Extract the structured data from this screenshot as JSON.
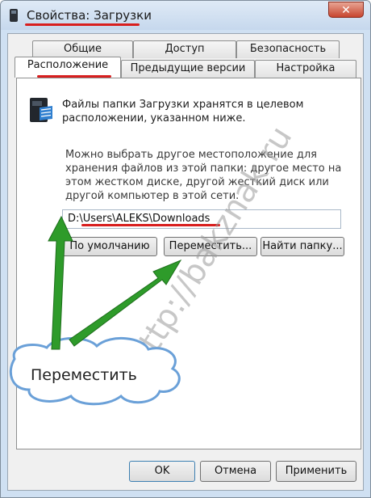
{
  "window": {
    "title": "Свойства: Загрузки",
    "close_label": "✕"
  },
  "tabs_row1": [
    "Общие",
    "Доступ",
    "Безопасность"
  ],
  "tabs_row2": [
    "Расположение",
    "Предыдущие версии",
    "Настройка"
  ],
  "active_tab": "Расположение",
  "location": {
    "description": "Файлы папки Загрузки хранятся в целевом расположении, указанном ниже.",
    "hint": "Можно выбрать другое местоположение для хранения файлов из этой папки: другое место на этом жестком диске, другой жесткий диск или другой компьютер в этой сети.",
    "path": "D:\\Users\\ALEKS\\Downloads"
  },
  "buttons": {
    "default": "По умолчанию",
    "move": "Переместить...",
    "find": "Найти папку..."
  },
  "footer": {
    "ok": "OK",
    "cancel": "Отмена",
    "apply": "Применить"
  },
  "annotation": {
    "callout": "Переместить",
    "watermark": "http://bakznak.ru"
  },
  "colors": {
    "highlight": "#d81e1e",
    "arrow": "#2e9b2a",
    "callout_border": "#6aa0d8"
  }
}
